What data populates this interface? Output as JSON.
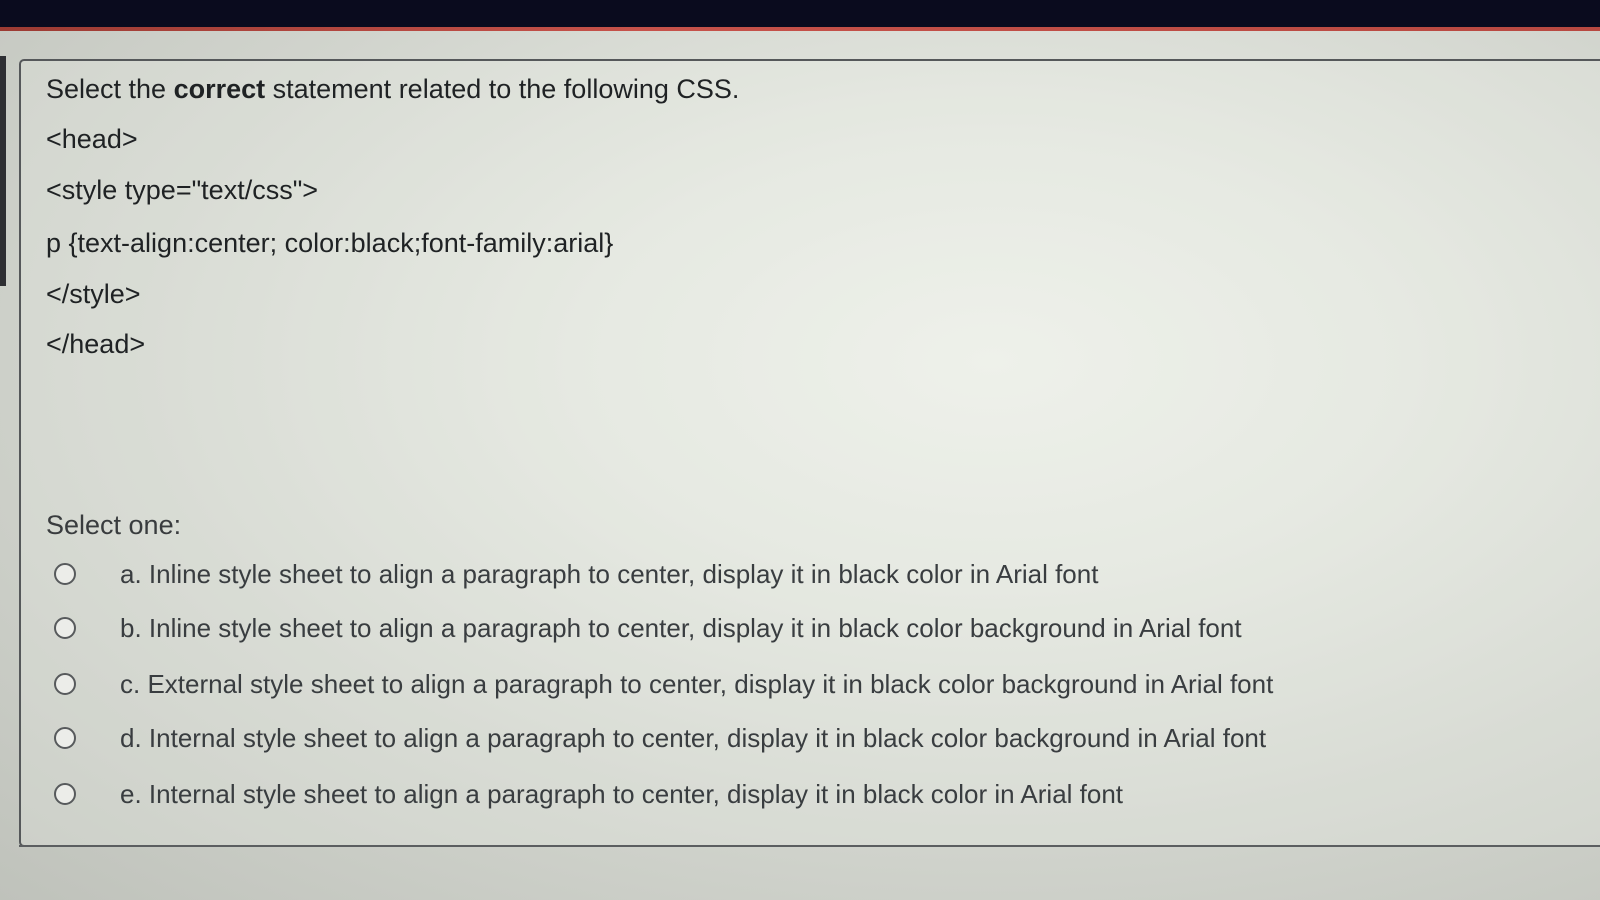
{
  "question": {
    "prompt_before": "Select the ",
    "prompt_bold": "correct",
    "prompt_after": " statement related to the following CSS.",
    "code_lines": [
      "<head>",
      "<style type=\"text/css\">",
      "p {text-align:center; color:black;font-family:arial}",
      "</style>",
      "</head>"
    ],
    "select_label": "Select one:",
    "options": [
      "a. Inline style sheet to align a paragraph to center, display it in black color in Arial font",
      "b. Inline style sheet to align a paragraph to center, display it in black color background in Arial font",
      "c. External style sheet to align a paragraph to center, display it in black color background in Arial font",
      "d. Internal style sheet to align a paragraph to center, display it in black color background in Arial font",
      "e. Internal style sheet to align a paragraph to center, display it in black color in Arial font"
    ]
  },
  "colors": {
    "top_bar": "#0a0b1e",
    "accent": "#c6524a",
    "text": "#1f2224",
    "border": "#55585a"
  }
}
